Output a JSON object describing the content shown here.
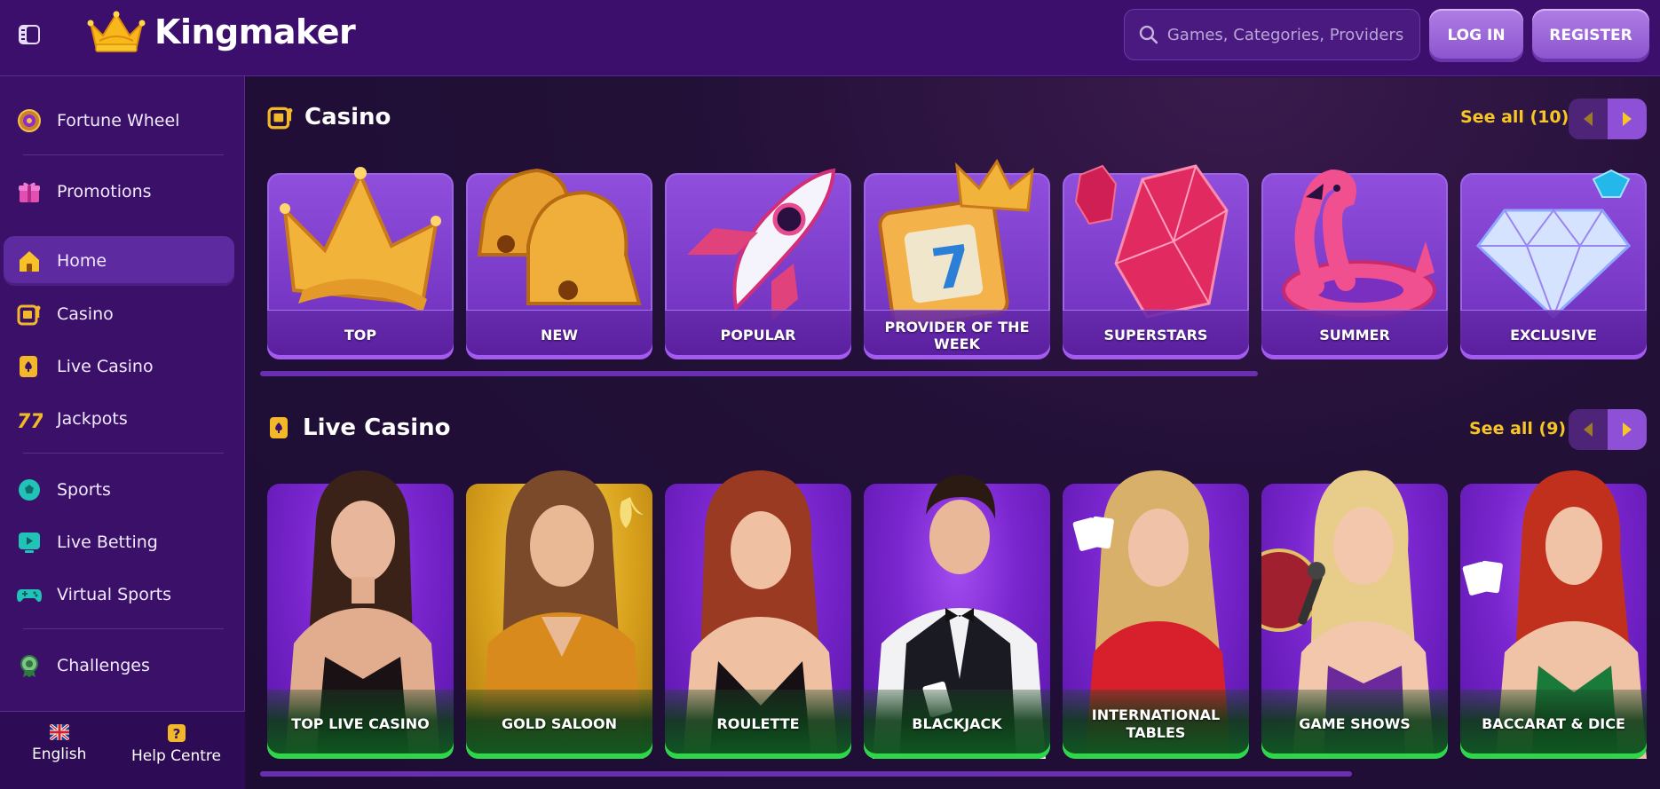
{
  "header": {
    "brand": "Kingmaker",
    "search_placeholder": "Games, Categories, Providers",
    "login_label": "LOG IN",
    "register_label": "REGISTER"
  },
  "sidebar": {
    "items": [
      {
        "label": "Fortune Wheel",
        "icon": "fortune-wheel-icon"
      },
      {
        "label": "Promotions",
        "icon": "gift-icon"
      },
      {
        "label": "Home",
        "icon": "home-icon",
        "active": true
      },
      {
        "label": "Casino",
        "icon": "slot-machine-icon"
      },
      {
        "label": "Live Casino",
        "icon": "playing-card-icon"
      },
      {
        "label": "Jackpots",
        "icon": "sevens-icon"
      },
      {
        "label": "Sports",
        "icon": "football-icon"
      },
      {
        "label": "Live Betting",
        "icon": "live-play-icon"
      },
      {
        "label": "Virtual Sports",
        "icon": "gamepad-icon"
      },
      {
        "label": "Challenges",
        "icon": "medal-icon"
      }
    ],
    "footer": {
      "language_label": "English",
      "help_label": "Help Centre"
    }
  },
  "casino": {
    "title": "Casino",
    "see_all": "See all (10)",
    "cards": [
      {
        "label": "TOP",
        "art": "crown"
      },
      {
        "label": "NEW",
        "art": "bells"
      },
      {
        "label": "POPULAR",
        "art": "rocket"
      },
      {
        "label": "PROVIDER OF THE WEEK",
        "art": "slot-seven"
      },
      {
        "label": "SUPERSTARS",
        "art": "ruby"
      },
      {
        "label": "SUMMER",
        "art": "flamingo"
      },
      {
        "label": "EXCLUSIVE",
        "art": "diamond"
      }
    ]
  },
  "live_casino": {
    "title": "Live Casino",
    "see_all": "See all (9)",
    "cards": [
      {
        "label": "TOP LIVE CASINO"
      },
      {
        "label": "GOLD SALOON"
      },
      {
        "label": "ROULETTE"
      },
      {
        "label": "BLACKJACK"
      },
      {
        "label": "INTERNATIONAL TABLES"
      },
      {
        "label": "GAME SHOWS"
      },
      {
        "label": "BACCARAT & DICE"
      }
    ]
  },
  "colors": {
    "header_bg": "#3b0f6b",
    "sidebar_bg": "#3a1068",
    "accent_yellow": "#f6c624",
    "button_purple": "#9a62dc",
    "live_accent_green": "#2fd64a"
  }
}
